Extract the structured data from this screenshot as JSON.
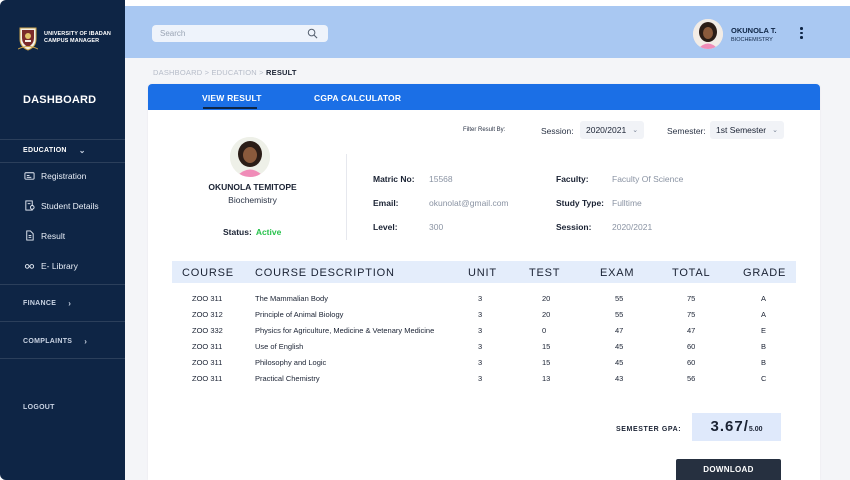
{
  "brand": {
    "line1": "UNIVERSITY OF IBADAN",
    "line2": "CAMPUS MANAGER"
  },
  "sidebar": {
    "title": "DASHBOARD",
    "education": "EDUCATION",
    "items": [
      {
        "label": "Registration",
        "icon": "card-icon"
      },
      {
        "label": "Student Details",
        "icon": "user-document-icon"
      },
      {
        "label": "Result",
        "icon": "document-icon"
      },
      {
        "label": "E- Library",
        "icon": "glasses-icon"
      }
    ],
    "finance": "FINANCE",
    "complaints": "COMPLAINTS",
    "logout": "LOGOUT"
  },
  "topbar": {
    "search_placeholder": "Search",
    "user_name": "OKUNOLA T.",
    "user_dept": "BIOCHEMISTRY"
  },
  "breadcrumb": {
    "path": "DASHBOARD > EDUCATION > ",
    "current": "RESULT"
  },
  "tabs": [
    "VIEW RESULT",
    "CGPA CALCULATOR"
  ],
  "filters": {
    "label": "Filter Result By:",
    "session_label": "Session:",
    "session_value": "2020/2021",
    "semester_label": "Semester:",
    "semester_value": "1st Semester"
  },
  "profile": {
    "name": "OKUNOLA TEMITOPE",
    "dept": "Biochemistry",
    "status_label": "Status:",
    "status_value": "Active"
  },
  "info": {
    "matric_label": "Matric No:",
    "matric_value": "15568",
    "email_label": "Email:",
    "email_value": "okunolat@gmail.com",
    "level_label": "Level:",
    "level_value": "300",
    "faculty_label": "Faculty:",
    "faculty_value": "Faculty Of Science",
    "study_label": "Study Type:",
    "study_value": "Fulltime",
    "session_label": "Session:",
    "session_value": "2020/2021"
  },
  "table": {
    "headers": [
      "COURSE",
      "COURSE DESCRIPTION",
      "UNIT",
      "TEST",
      "EXAM",
      "TOTAL",
      "GRADE"
    ],
    "rows": [
      [
        "ZOO 311",
        "The Mammalian Body",
        "3",
        "20",
        "55",
        "75",
        "A"
      ],
      [
        "ZOO 312",
        "Principle of Animal Biology",
        "3",
        "20",
        "55",
        "75",
        "A"
      ],
      [
        "ZOO 332",
        "Physics for Agriculture, Medicine & Vetenary Medicine",
        "3",
        "0",
        "47",
        "47",
        "E"
      ],
      [
        "ZOO 311",
        "Use of English",
        "3",
        "15",
        "45",
        "60",
        "B"
      ],
      [
        "ZOO 311",
        "Philosophy and Logic",
        "3",
        "15",
        "45",
        "60",
        "B"
      ],
      [
        "ZOO 311",
        "Practical Chemistry",
        "3",
        "13",
        "43",
        "56",
        "C"
      ]
    ]
  },
  "gpa": {
    "label": "SEMESTER GPA:",
    "value": "3.67",
    "slash": "/",
    "max": "5.00"
  },
  "download_label": "DOWNLOAD",
  "colors": {
    "sidebar": "#0e2545",
    "topbar": "#a9c8f2",
    "tabs": "#1b6fe6",
    "active": "#27c24c"
  }
}
